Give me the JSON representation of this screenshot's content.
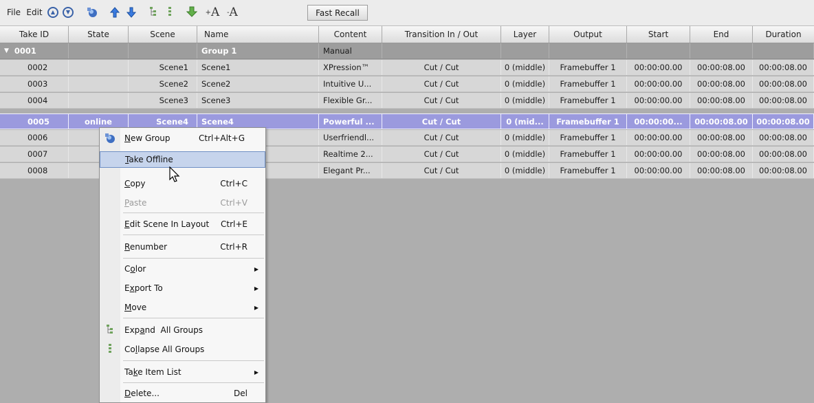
{
  "toolbar": {
    "menu_file": "File",
    "menu_edit": "Edit",
    "font_up": "A",
    "font_down": "A",
    "fast_recall": "Fast Recall"
  },
  "columns": [
    "Take ID",
    "State",
    "Scene",
    "Name",
    "Content",
    "Transition In / Out",
    "Layer",
    "Output",
    "Start",
    "End",
    "Duration"
  ],
  "group_row": {
    "take_id": "0001",
    "name": "Group 1",
    "content": "Manual"
  },
  "rows": [
    {
      "take_id": "0002",
      "state": "",
      "scene": "Scene1",
      "name": "Scene1",
      "content": "XPression™",
      "transition": "Cut / Cut",
      "layer": "0 (middle)",
      "output": "Framebuffer 1",
      "start": "00:00:00.00",
      "end": "00:00:08.00",
      "duration": "00:00:08.00"
    },
    {
      "take_id": "0003",
      "state": "",
      "scene": "Scene2",
      "name": "Scene2",
      "content": "Intuitive U...",
      "transition": "Cut / Cut",
      "layer": "0 (middle)",
      "output": "Framebuffer 1",
      "start": "00:00:00.00",
      "end": "00:00:08.00",
      "duration": "00:00:08.00"
    },
    {
      "take_id": "0004",
      "state": "",
      "scene": "Scene3",
      "name": "Scene3",
      "content": "Flexible Gr...",
      "transition": "Cut / Cut",
      "layer": "0 (middle)",
      "output": "Framebuffer 1",
      "start": "00:00:00.00",
      "end": "00:00:08.00",
      "duration": "00:00:08.00"
    },
    {
      "take_id": "0005",
      "state": "online",
      "scene": "Scene4",
      "name": "Scene4",
      "content": "Powerful ...",
      "transition": "Cut / Cut",
      "layer": "0 (mid...",
      "output": "Framebuffer 1",
      "start": "00:00:00...",
      "end": "00:00:08.00",
      "duration": "00:00:08.00"
    },
    {
      "take_id": "0006",
      "state": "",
      "scene": "",
      "name": "",
      "content": "Userfriendl...",
      "transition": "Cut / Cut",
      "layer": "0 (middle)",
      "output": "Framebuffer 1",
      "start": "00:00:00.00",
      "end": "00:00:08.00",
      "duration": "00:00:08.00"
    },
    {
      "take_id": "0007",
      "state": "",
      "scene": "",
      "name": "",
      "content": "Realtime 2...",
      "transition": "Cut / Cut",
      "layer": "0 (middle)",
      "output": "Framebuffer 1",
      "start": "00:00:00.00",
      "end": "00:00:08.00",
      "duration": "00:00:08.00"
    },
    {
      "take_id": "0008",
      "state": "",
      "scene": "",
      "name": "",
      "content": "Elegant Pr...",
      "transition": "Cut / Cut",
      "layer": "0 (middle)",
      "output": "Framebuffer 1",
      "start": "00:00:00.00",
      "end": "00:00:08.00",
      "duration": "00:00:08.00"
    }
  ],
  "menu": {
    "new_group": {
      "pre": "",
      "ul": "N",
      "post": "ew Group",
      "shortcut": "Ctrl+Alt+G"
    },
    "take_offline": {
      "pre": "",
      "ul": "T",
      "post": "ake Offline"
    },
    "copy": {
      "pre": "",
      "ul": "C",
      "post": "opy",
      "shortcut": "Ctrl+C"
    },
    "paste": {
      "pre": "",
      "ul": "P",
      "post": "aste",
      "shortcut": "Ctrl+V"
    },
    "edit_scene": {
      "pre": "",
      "ul": "E",
      "post": "dit Scene In Layout",
      "shortcut": "Ctrl+E"
    },
    "renumber": {
      "pre": "",
      "ul": "R",
      "post": "enumber",
      "shortcut": "Ctrl+R"
    },
    "color": {
      "pre": "C",
      "ul": "o",
      "post": "lor"
    },
    "export_to": {
      "pre": "E",
      "ul": "x",
      "post": "port To"
    },
    "move": {
      "pre": "",
      "ul": "M",
      "post": "ove"
    },
    "expand": {
      "pre": "Exp",
      "ul": "a",
      "post": "nd  All Groups"
    },
    "collapse": {
      "pre": "Co",
      "ul": "l",
      "post": "lapse All Groups"
    },
    "take_item_list": {
      "pre": "Ta",
      "ul": "k",
      "post": "e Item List"
    },
    "delete": {
      "pre": "",
      "ul": "D",
      "post": "elete...",
      "shortcut": "Del"
    }
  }
}
